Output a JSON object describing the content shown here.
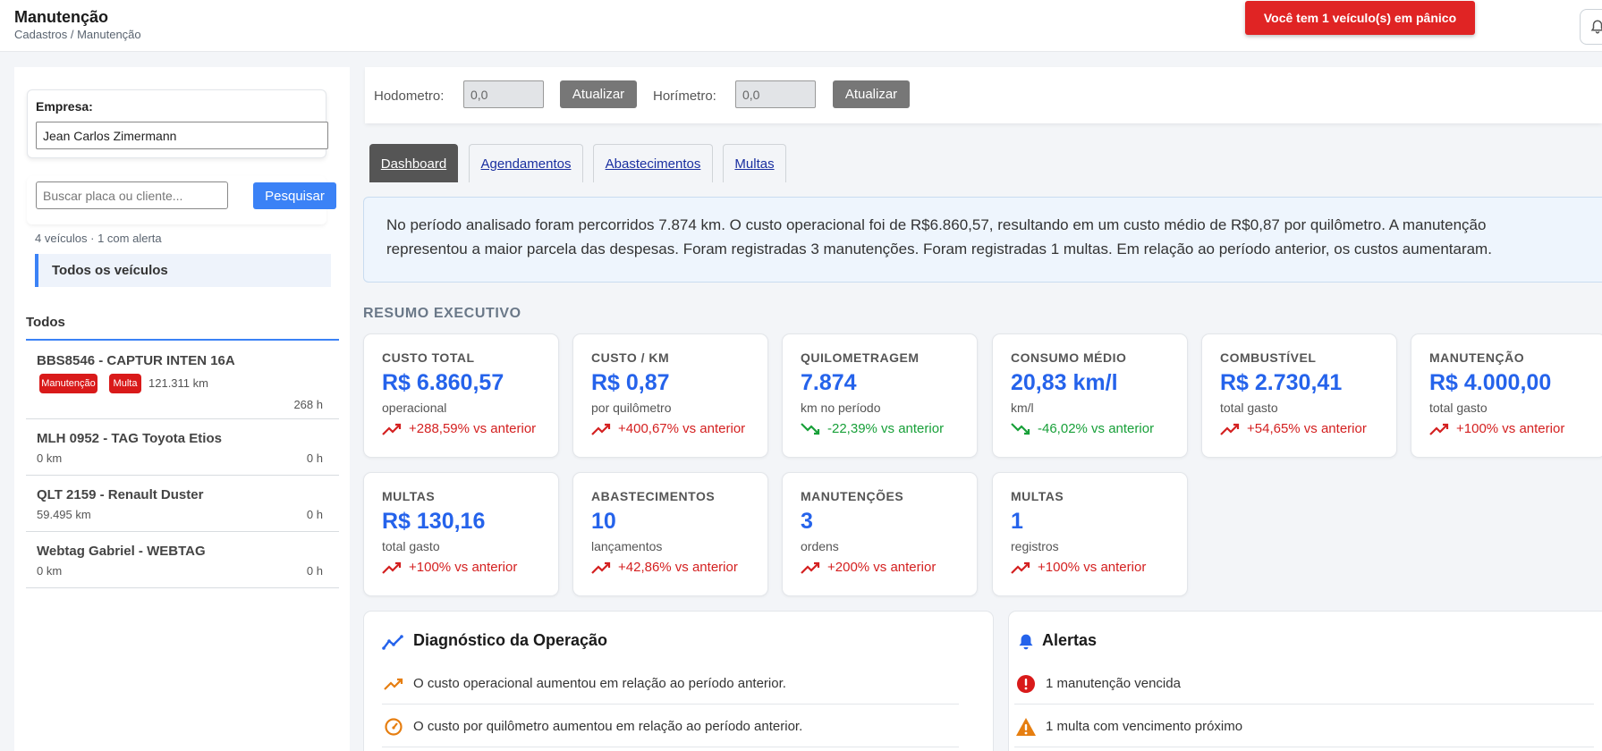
{
  "header": {
    "title": "Manutenção",
    "breadcrumb": "Cadastros / Manutenção",
    "panic_alert": "Você tem 1 veículo(s) em pânico"
  },
  "sidebar": {
    "company_label": "Empresa:",
    "company_value": "Jean Carlos Zimermann",
    "search_placeholder": "Buscar placa ou cliente...",
    "search_button": "Pesquisar",
    "count_text": "4 veículos · 1 com alerta",
    "all_vehicles": "Todos os veículos",
    "group_label": "Todos",
    "vehicles": [
      {
        "name": "BBS8546 - CAPTUR INTEN 16A",
        "badges": [
          "Manutenção",
          "Multa"
        ],
        "km": "121.311 km",
        "hours": "268 h"
      },
      {
        "name": "MLH 0952 - TAG Toyota Etios",
        "km": "0 km",
        "hours": "0 h"
      },
      {
        "name": "QLT 2159 - Renault Duster",
        "km": "59.495 km",
        "hours": "0 h"
      },
      {
        "name": "Webtag Gabriel - WEBTAG",
        "km": "0 km",
        "hours": "0 h"
      }
    ]
  },
  "toolbar": {
    "odometer_label": "Hodometro:",
    "odometer_value": "0,0",
    "update_label": "Atualizar",
    "hourmeter_label": "Horímetro:",
    "hourmeter_value": "0,0"
  },
  "tabs": [
    "Dashboard",
    "Agendamentos",
    "Abastecimentos",
    "Multas"
  ],
  "summary": {
    "line1": "No período analisado foram percorridos 7.874 km. O custo operacional foi de R$6.860,57, resultando em um custo médio de R$0,87 por quilômetro. A manutenção",
    "line2": "representou a maior parcela das despesas. Foram registradas 3 manutenções. Foram registradas 1 multas. Em relação ao período anterior, os custos aumentaram."
  },
  "section_title": "RESUMO EXECUTIVO",
  "kpis": [
    {
      "label": "CUSTO TOTAL",
      "value": "R$ 6.860,57",
      "sub": "operacional",
      "trend": "+288,59% vs anterior",
      "dir": "up"
    },
    {
      "label": "CUSTO / KM",
      "value": "R$ 0,87",
      "sub": "por quilômetro",
      "trend": "+400,67% vs anterior",
      "dir": "up"
    },
    {
      "label": "QUILOMETRAGEM",
      "value": "7.874",
      "sub": "km no período",
      "trend": "-22,39% vs anterior",
      "dir": "down"
    },
    {
      "label": "CONSUMO MÉDIO",
      "value": "20,83 km/l",
      "sub": "km/l",
      "trend": "-46,02% vs anterior",
      "dir": "down"
    },
    {
      "label": "COMBUSTÍVEL",
      "value": "R$ 2.730,41",
      "sub": "total gasto",
      "trend": "+54,65% vs anterior",
      "dir": "up"
    },
    {
      "label": "MANUTENÇÃO",
      "value": "R$ 4.000,00",
      "sub": "total gasto",
      "trend": "+100% vs anterior",
      "dir": "up"
    },
    {
      "label": "MULTAS",
      "value": "R$ 130,16",
      "sub": "total gasto",
      "trend": "+100% vs anterior",
      "dir": "up"
    },
    {
      "label": "ABASTECIMENTOS",
      "value": "10",
      "sub": "lançamentos",
      "trend": "+42,86% vs anterior",
      "dir": "up"
    },
    {
      "label": "MANUTENÇÕES",
      "value": "3",
      "sub": "ordens",
      "trend": "+200% vs anterior",
      "dir": "up"
    },
    {
      "label": "MULTAS",
      "value": "1",
      "sub": "registros",
      "trend": "+100% vs anterior",
      "dir": "up"
    }
  ],
  "diagnostics": {
    "title": "Diagnóstico da Operação",
    "items": [
      "O custo operacional aumentou em relação ao período anterior.",
      "O custo por quilômetro aumentou em relação ao período anterior."
    ]
  },
  "alerts": {
    "title": "Alertas",
    "items": [
      "1 manutenção vencida",
      "1 multa com vencimento próximo"
    ]
  },
  "colors": {
    "accent": "#3b82f6",
    "value_blue": "#2563eb",
    "danger": "#e02424",
    "positive_green": "#18a039"
  }
}
